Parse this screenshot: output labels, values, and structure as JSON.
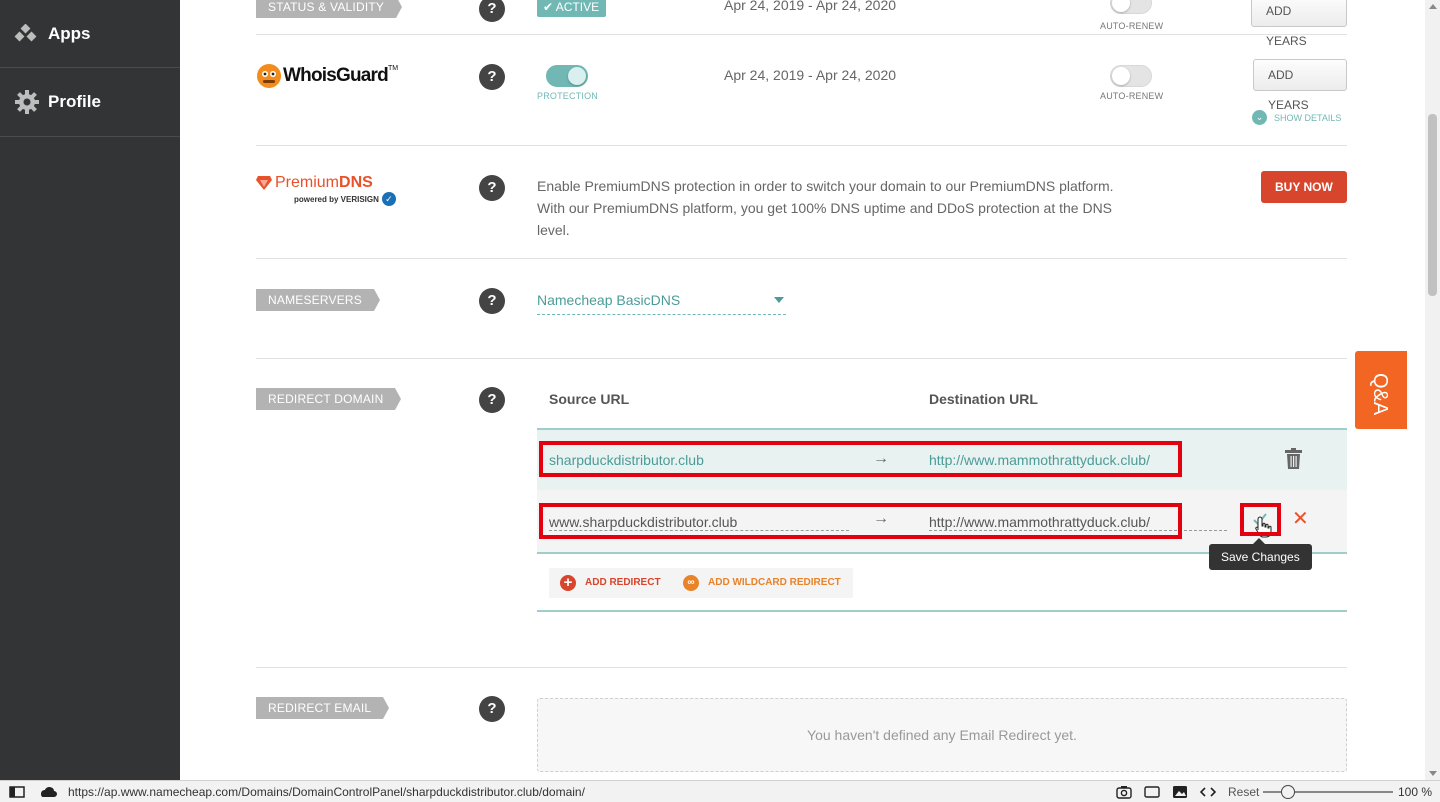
{
  "sidebar": {
    "items": [
      {
        "label": "Apps",
        "icon": "apps-icon"
      },
      {
        "label": "Profile",
        "icon": "gear-icon"
      }
    ]
  },
  "status_validity": {
    "tag": "STATUS & VALIDITY",
    "badge": "ACTIVE",
    "dates": "Apr 24, 2019 - Apr 24, 2020",
    "auto_renew_label": "AUTO-RENEW",
    "button": "ADD YEARS"
  },
  "whoisguard": {
    "logo_text": "WhoisGuard",
    "toggle_label": "PROTECTION",
    "dates": "Apr 24, 2019 - Apr 24, 2020",
    "auto_renew_label": "AUTO-RENEW",
    "button": "ADD YEARS",
    "show_details": "SHOW DETAILS"
  },
  "premiumdns": {
    "logo_premium": "Premium",
    "logo_dns": "DNS",
    "powered_by": "powered by VERISIGN",
    "description": "Enable PremiumDNS protection in order to switch your domain to our PremiumDNS platform. With our PremiumDNS platform, you get 100% DNS uptime and DDoS protection at the DNS level.",
    "button": "BUY NOW"
  },
  "nameservers": {
    "tag": "NAMESERVERS",
    "selected": "Namecheap BasicDNS"
  },
  "redirect_domain": {
    "tag": "REDIRECT DOMAIN",
    "source_header": "Source URL",
    "destination_header": "Destination URL",
    "rows": [
      {
        "source": "sharpduckdistributor.club",
        "arrow": "→",
        "destination": "http://www.mammothrattyduck.club/"
      },
      {
        "source": "www.sharpduckdistributor.club",
        "arrow": "→",
        "destination": "http://www.mammothrattyduck.club/"
      }
    ],
    "tooltip": "Save Changes",
    "add_redirect": "ADD REDIRECT",
    "add_wildcard": "ADD WILDCARD REDIRECT"
  },
  "redirect_email": {
    "tag": "REDIRECT EMAIL",
    "empty_text": "You haven't defined any Email Redirect yet."
  },
  "help_glyph": "?",
  "qa_label": "Q&A",
  "statusbar": {
    "url": "https://ap.www.namecheap.com/Domains/DomainControlPanel/sharpduckdistributor.club/domain/",
    "reset": "Reset",
    "zoom": "100 %"
  },
  "colors": {
    "sidebar_bg": "#333435",
    "teal": "#71b8b4",
    "orange_red": "#d7452c",
    "qa_orange": "#f26522",
    "highlight_red": "#e3000f"
  }
}
